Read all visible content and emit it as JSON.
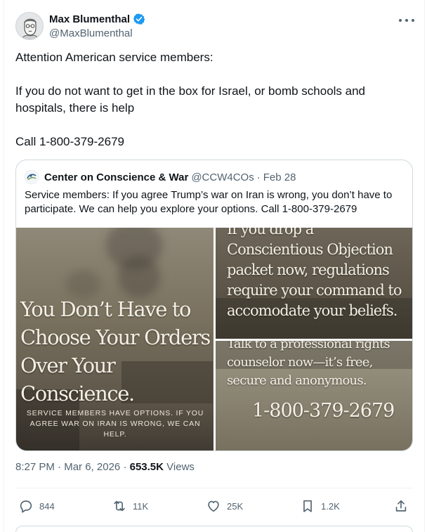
{
  "author": {
    "display_name": "Max Blumenthal",
    "handle": "@MaxBlumenthal",
    "verified": true
  },
  "tweet": {
    "line1": "Attention American service members:",
    "line2": "If you do not want to get in the box for Israel, or bomb schools and hospitals, there is help",
    "line3": "Call 1-800-379-2679"
  },
  "quote": {
    "display_name": "Center on Conscience & War",
    "handle": "@CCW4COs",
    "separator": "·",
    "date": "Feb 28",
    "text": "Service members: If you agree Trump’s war on Iran is wrong, you don’t have to participate. We can help you explore your options. Call 1-800-379-2679",
    "images": {
      "panel1_title": "You Don’t Have to Choose Your Orders Over Your Conscience.",
      "panel1_sub": "SERVICE MEMBERS HAVE OPTIONS. IF YOU AGREE WAR ON IRAN IS WRONG, WE CAN HELP.",
      "panel2_text": "If you drop a Conscientious Objection packet now, regulations require your command to accomodate your beliefs.",
      "panel3_text": "Talk to a professional rights counselor now—it’s free, secure and anonymous.",
      "panel3_phone": "1-800-379-2679"
    }
  },
  "meta": {
    "time": "8:27 PM",
    "dot1": "·",
    "date": "Mar 6, 2026",
    "dot2": "·",
    "views_count": "653.5K",
    "views_label": "Views"
  },
  "actions": {
    "replies": "844",
    "reposts": "11K",
    "likes": "25K",
    "bookmarks": "1.2K"
  },
  "colors": {
    "text_primary": "#0f1419",
    "text_secondary": "#536471",
    "verified_blue": "#1d9bf0",
    "border": "#cfd9de"
  }
}
